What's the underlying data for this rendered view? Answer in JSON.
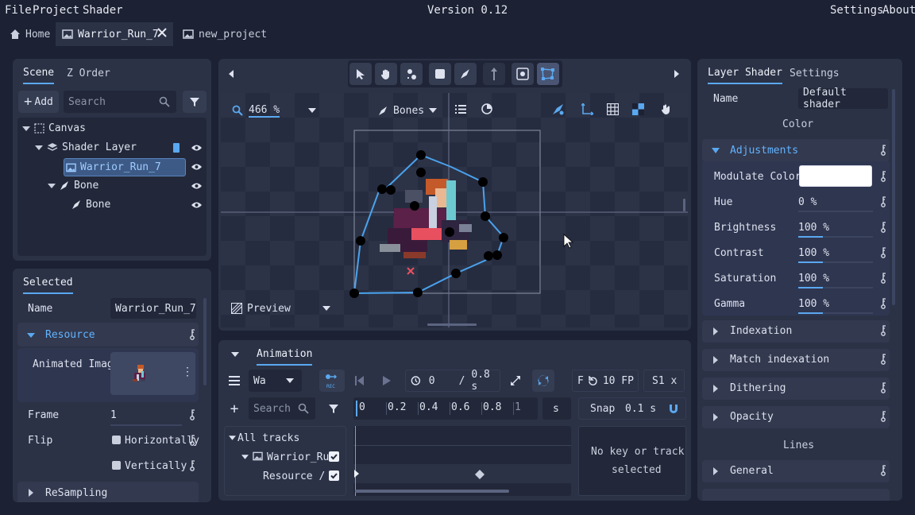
{
  "menu": {
    "file": "File",
    "project": "Project",
    "shader": "Shader",
    "version": "Version 0.12",
    "settings": "Settings",
    "about": "About"
  },
  "tabs": {
    "home": "Home",
    "warrior": "Warrior_Run_7",
    "new_project": "new_project"
  },
  "scene_panel": {
    "tab_scene": "Scene",
    "tab_zorder": "Z Order",
    "add": "Add",
    "search_placeholder": "Search",
    "tree": {
      "canvas": "Canvas",
      "shader_layer": "Shader Layer",
      "warrior": "Warrior_Run_7",
      "bone_parent": "Bone",
      "bone_child": "Bone"
    }
  },
  "selected_panel": {
    "title": "Selected",
    "name_label": "Name",
    "name_value": "Warrior_Run_7",
    "resource": "Resource",
    "animated_image": "Animated Image",
    "frame_label": "Frame",
    "frame_value": "1",
    "flip_label": "Flip",
    "horizontally": "Horizontally",
    "vertically": "Vertically",
    "resampling": "ReSampling"
  },
  "viewport": {
    "zoom": "466 %",
    "bones": "Bones",
    "preview": "Preview"
  },
  "animation": {
    "title": "Animation",
    "track_select": "Wa",
    "rec": "REC",
    "time_current": "0",
    "time_sep": "/",
    "time_total": "0.8 s",
    "fps_label": "F",
    "fps_value": "10 FP",
    "speed": "S1 x",
    "search_placeholder": "Search",
    "ruler": [
      "0",
      "0.2",
      "0.4",
      "0.6",
      "0.8",
      "1"
    ],
    "ruler_unit": "s",
    "snap_label": "Snap",
    "snap_value": "0.1 s",
    "all_tracks": "All tracks",
    "track_warrior": "Warrior_Ru",
    "track_resource": "Resource /",
    "no_key_line1": "No key or track",
    "no_key_line2": "selected"
  },
  "layer_shader": {
    "tab_shader": "Layer Shader",
    "tab_settings": "Settings",
    "name_label": "Name",
    "name_value": "Default shader",
    "color_header": "Color",
    "adjustments": "Adjustments",
    "modulate_label": "Modulate Color",
    "modulate_color": "#ffffff",
    "props": [
      {
        "label": "Hue",
        "value": "0 %",
        "fill": 0.0
      },
      {
        "label": "Brightness",
        "value": "100 %",
        "fill": 0.33
      },
      {
        "label": "Contrast",
        "value": "100 %",
        "fill": 0.33
      },
      {
        "label": "Saturation",
        "value": "100 %",
        "fill": 0.33
      },
      {
        "label": "Gamma",
        "value": "100 %",
        "fill": 0.33
      }
    ],
    "sections": [
      "Indexation",
      "Match indexation",
      "Dithering",
      "Opacity"
    ],
    "lines_header": "Lines",
    "general": "General"
  },
  "colors": {
    "accent": "#5aa8f0",
    "panel": "#2b3246",
    "bg": "#1c2133",
    "bone": "#4aa3ee"
  }
}
